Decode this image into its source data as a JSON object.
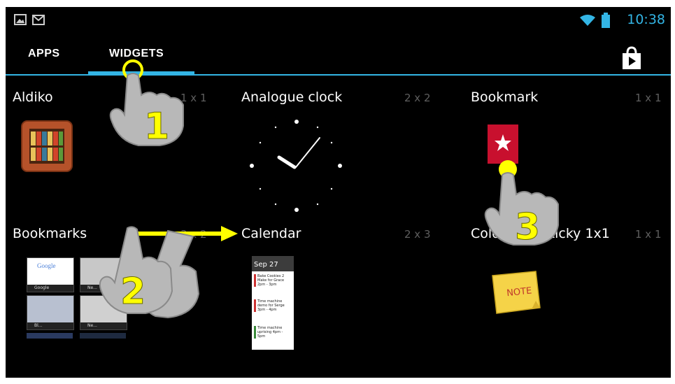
{
  "status_bar": {
    "time": "10:38",
    "notifications": [
      "image-notification-icon",
      "gmail-notification-icon"
    ],
    "icons": [
      "wifi-icon",
      "battery-icon"
    ]
  },
  "tabs": [
    {
      "label": "APPS",
      "selected": false
    },
    {
      "label": "WIDGETS",
      "selected": true
    }
  ],
  "store_icon": "play-store-icon",
  "widgets": [
    {
      "name": "Aldiko",
      "size": "1 x 1",
      "icon": "aldiko-bookshelf-icon"
    },
    {
      "name": "Analogue clock",
      "size": "2 x 2",
      "icon": "analog-clock-icon"
    },
    {
      "name": "Bookmark",
      "size": "1 x 1",
      "icon": "bookmark-star-icon"
    },
    {
      "name": "Bookmarks",
      "size": "3 x 2",
      "icon": "bookmarks-thumbnails"
    },
    {
      "name": "Calendar",
      "size": "2 x 3",
      "icon": "calendar-preview"
    },
    {
      "name": "ColorNote Sticky 1x1",
      "size": "1 x 1",
      "icon": "note-icon"
    }
  ],
  "bookmark_thumbs": [
    {
      "label": "Google",
      "top_text": "Google"
    },
    {
      "label": "Ne...",
      "top_text": ""
    },
    {
      "label": "Bl...",
      "top_text": ""
    },
    {
      "label": "Ne...",
      "top_text": ""
    }
  ],
  "calendar_preview": {
    "date": "Sep 27",
    "events": [
      "Bake Cookies 2 Make for Grace 2pm - 3pm",
      "Time machine demo for Serge 3pm - 4pm",
      "Time machine uprising 4pm - 5pm"
    ]
  },
  "note_label": "NOTE",
  "annotations": {
    "step1": "1",
    "step2": "2",
    "step3": "3"
  },
  "colors": {
    "accent": "#33b5e5",
    "annotation": "#ffff00",
    "hand": "#b8b8b8",
    "background": "#000000"
  }
}
